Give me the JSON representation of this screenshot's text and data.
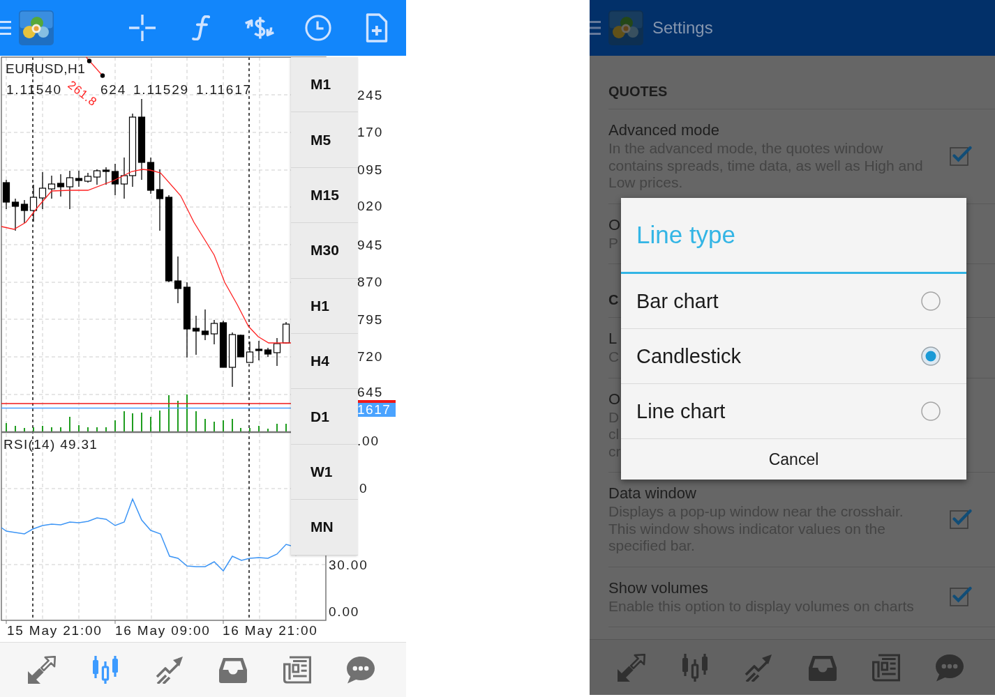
{
  "left_screen": {
    "chart": {
      "symbol": "EURUSD,H1",
      "ohlc": [
        "1.11540",
        "624",
        "1.11529",
        "1.11617"
      ],
      "fibonacci_label": "261.8",
      "price_labels": [
        "245",
        "170",
        "095",
        "020",
        "945",
        "870",
        "795",
        "720",
        "645"
      ],
      "price_tag": "1617",
      "rsi_label": "RSI(14) 49.31",
      "rsi_labels": [
        ".00",
        "0",
        "30.00",
        "0.00"
      ],
      "time_labels": [
        "15 May 21:00",
        "16 May 09:00",
        "16 May 21:00"
      ]
    },
    "timeframes": [
      {
        "label": "M1",
        "selected": false
      },
      {
        "label": "M5",
        "selected": false
      },
      {
        "label": "M15",
        "selected": false
      },
      {
        "label": "M30",
        "selected": false
      },
      {
        "label": "H1",
        "selected": false
      },
      {
        "label": "H4",
        "selected": false
      },
      {
        "label": "D1",
        "selected": false
      },
      {
        "label": "W1",
        "selected": false
      },
      {
        "label": "MN",
        "selected": false
      }
    ],
    "bottom_nav": [
      {
        "selected": false
      },
      {
        "selected": true
      },
      {
        "selected": false
      },
      {
        "selected": false
      },
      {
        "selected": false
      },
      {
        "selected": false
      }
    ]
  },
  "right_screen": {
    "title": "Settings",
    "sections": [
      {
        "heading": "QUOTES",
        "items": [
          {
            "kind": "option",
            "title": "Advanced mode",
            "description": "In the advanced mode, the quotes window contains spreads, time data, as well as High and Low prices.",
            "checked": true
          },
          {
            "kind": "partial",
            "title": "O",
            "lines": [
              "P"
            ]
          }
        ]
      },
      {
        "heading": "C",
        "items": [
          {
            "kind": "partial",
            "title": "L",
            "lines": [
              "C"
            ]
          },
          {
            "kind": "partial",
            "title": "O",
            "lines": [
              "D",
              "cl",
              "cr"
            ]
          },
          {
            "kind": "option",
            "title": "Data window",
            "description": "Displays a pop-up window near the crosshair. This window shows indicator values on the specified bar.",
            "checked": true
          },
          {
            "kind": "option",
            "title": "Show volumes",
            "description": "Enable this option to display volumes on charts",
            "checked": true
          }
        ]
      }
    ],
    "dialog": {
      "title": "Line type",
      "options": [
        {
          "label": "Bar chart",
          "selected": false
        },
        {
          "label": "Candlestick",
          "selected": true
        },
        {
          "label": "Line chart",
          "selected": false
        }
      ],
      "button": "Cancel"
    },
    "bottom_nav": [
      {
        "selected": false
      },
      {
        "selected": false
      },
      {
        "selected": false
      },
      {
        "selected": false
      },
      {
        "selected": false
      },
      {
        "selected": false
      }
    ]
  }
}
